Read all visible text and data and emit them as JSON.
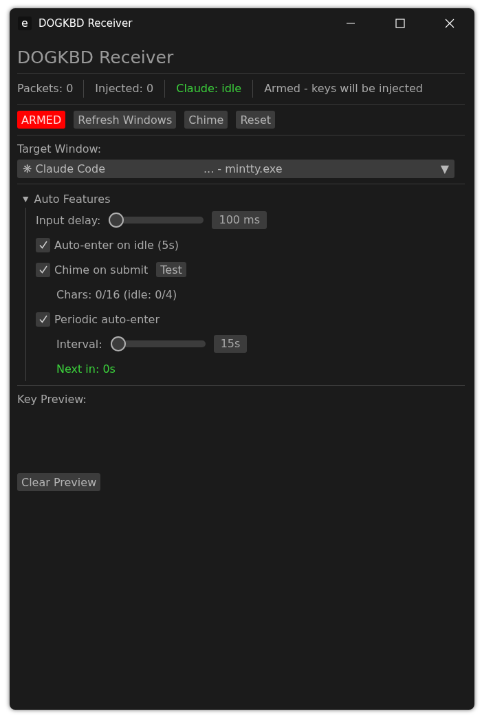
{
  "window": {
    "title": "DOGKBD Receiver",
    "app_icon": "e"
  },
  "heading": "DOGKBD Receiver",
  "status": [
    {
      "text": "Packets: 0",
      "color": "#a8a8a8"
    },
    {
      "text": "Injected: 0",
      "color": "#a8a8a8"
    },
    {
      "text": "Claude: idle",
      "color": "#3cd23c"
    },
    {
      "text": "Armed - keys will be injected",
      "color": "#a8a8a8"
    }
  ],
  "buttons": [
    {
      "label": "ARMED",
      "kind": "armed"
    },
    {
      "label": "Refresh Windows",
      "kind": "plain"
    },
    {
      "label": "Chime",
      "kind": "plain"
    },
    {
      "label": "Reset",
      "kind": "plain"
    }
  ],
  "target": {
    "label": "Target Window:",
    "value_left": "❋ Claude Code",
    "value_right": "... - mintty.exe",
    "arrow": "▼"
  },
  "auto_features": {
    "title": "Auto Features",
    "arrow": "▼",
    "expanded": true,
    "items": [
      {
        "kind": "slider",
        "label": "Input delay:",
        "level": 0,
        "reading": "100 ms"
      },
      {
        "kind": "checkbox",
        "label": "Auto-enter on idle (5s)",
        "checked": true
      },
      {
        "kind": "checkbox",
        "label": "Chime on submit",
        "checked": true,
        "button": "Test",
        "children": [
          {
            "kind": "note",
            "label": "Chars: 0/16 (idle: 0/4)"
          }
        ]
      },
      {
        "kind": "checkbox",
        "label": "Periodic auto-enter",
        "checked": true,
        "children": [
          {
            "kind": "slider",
            "label": "Interval:",
            "level": 0,
            "reading": "15s"
          },
          {
            "kind": "status",
            "label": "Next in: 0s"
          }
        ]
      }
    ]
  },
  "key_preview": {
    "label": "Key Preview:",
    "button": "Clear Preview"
  }
}
